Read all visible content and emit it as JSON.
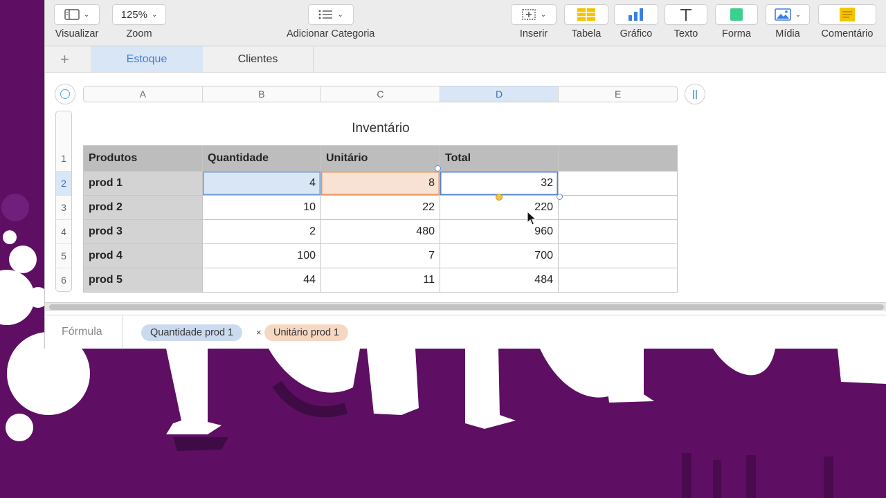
{
  "toolbar": {
    "view_label": "Visualizar",
    "zoom_label": "Zoom",
    "zoom_value": "125%",
    "category_label": "Adicionar Categoria",
    "insert_label": "Inserir",
    "table_label": "Tabela",
    "chart_label": "Gráfico",
    "text_label": "Texto",
    "shape_label": "Forma",
    "media_label": "Mídia",
    "comment_label": "Comentário",
    "icons": [
      "sidebar-view-icon",
      "list-icon",
      "insert-icon",
      "table-icon",
      "bar-chart-icon",
      "text-t-icon",
      "shape-square-icon",
      "media-image-icon",
      "comment-note-icon"
    ]
  },
  "tabs": {
    "add_label": "+",
    "items": [
      {
        "label": "Estoque",
        "active": true
      },
      {
        "label": "Clientes",
        "active": false
      }
    ]
  },
  "sheet": {
    "column_headers": [
      "A",
      "B",
      "C",
      "D",
      "E"
    ],
    "selected_column": "D",
    "row_headers": [
      "1",
      "2",
      "3",
      "4",
      "5",
      "6"
    ],
    "selected_row": "2",
    "table_title": "Inventário",
    "header": [
      "Produtos",
      "Quantidade",
      "Unitário",
      "Total",
      ""
    ],
    "rows": [
      [
        "prod 1",
        "4",
        "8",
        "32",
        ""
      ],
      [
        "prod 2",
        "10",
        "22",
        "220",
        ""
      ],
      [
        "prod 3",
        "2",
        "480",
        "960",
        ""
      ],
      [
        "prod 4",
        "100",
        "7",
        "700",
        ""
      ],
      [
        "prod 5",
        "44",
        "11",
        "484",
        ""
      ]
    ]
  },
  "formula": {
    "label": "Fórmula",
    "token_1": "Quantidade prod 1",
    "operator": "×",
    "token_2": "Unitário prod 1"
  },
  "colors": {
    "desktop": "#5e0f63",
    "accent_blue": "#3f7fd1",
    "ref_blue": "#d9e6f6",
    "ref_orange": "#f7e2d4",
    "header_gray": "#bdbdbd"
  }
}
